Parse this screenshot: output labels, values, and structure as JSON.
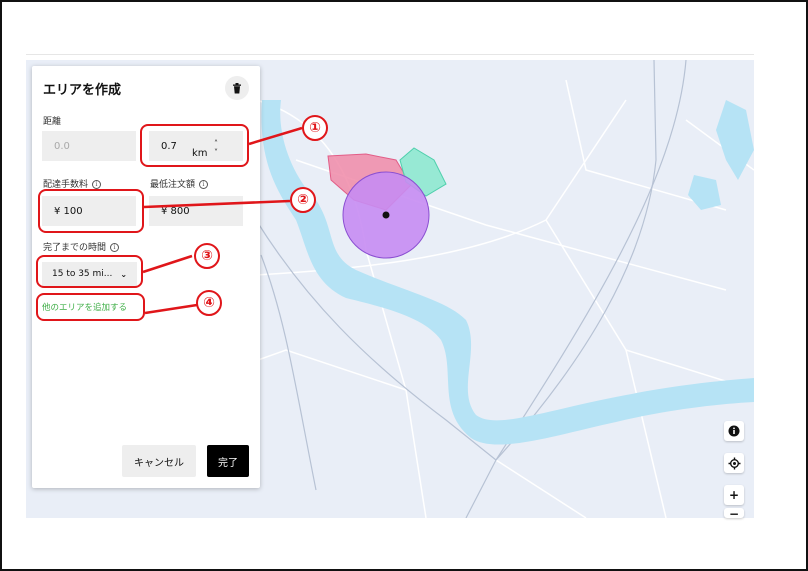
{
  "panel": {
    "title": "エリアを作成",
    "distance": {
      "label": "距離",
      "min_placeholder": "0.0",
      "value": "0.7",
      "unit": "km"
    },
    "delivery_fee": {
      "label": "配達手数料",
      "value": "¥ 100"
    },
    "min_order": {
      "label": "最低注文額",
      "value": "¥ 800"
    },
    "completion_time": {
      "label": "完了までの時間",
      "value": "15 to 35 mi..."
    },
    "add_area_link": "他のエリアを追加する",
    "cancel_label": "キャンセル",
    "done_label": "完了"
  },
  "annotations": [
    "①",
    "②",
    "③",
    "④"
  ],
  "icons": {
    "trash": "trash-icon",
    "info": "info-icon",
    "stepper": "stepper-arrows-icon",
    "chevron": "chevron-down-icon",
    "map_info": "map-info-icon",
    "locate": "locate-icon",
    "zoom_in": "zoom-in-icon",
    "zoom_out": "zoom-out-icon"
  },
  "map_controls": {
    "zoom_in": "+",
    "zoom_out": "−"
  },
  "colors": {
    "annotation": "#e0161a",
    "link_green": "#3fae47",
    "map_background": "#e9eef7",
    "water": "#b6e3f5",
    "zone_pink": "#f08aa8",
    "zone_teal": "#8ee8cf",
    "zone_purple": "#c78cf2"
  }
}
